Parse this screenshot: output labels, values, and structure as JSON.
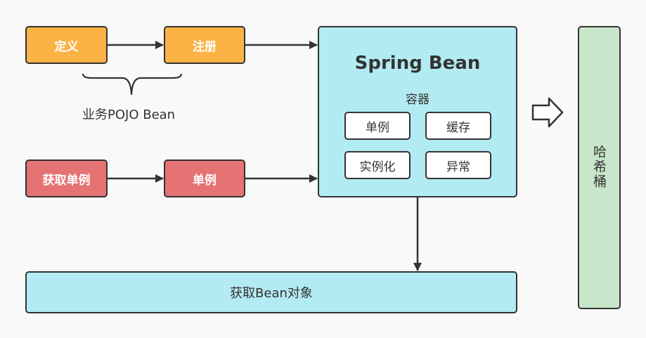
{
  "flow_top": {
    "define": "定义",
    "register": "注册",
    "brace_label": "业务POJO Bean"
  },
  "flow_bottom": {
    "get_singleton": "获取单例",
    "singleton": "单例"
  },
  "container": {
    "title": "Spring Bean",
    "subtitle": "容器",
    "items": [
      "单例",
      "缓存",
      "实例化",
      "异常"
    ]
  },
  "result": {
    "label": "获取Bean对象"
  },
  "hash_bucket": {
    "label": "哈希桶"
  },
  "colors": {
    "orange": "#fbb346",
    "red": "#e57373",
    "cyan": "#b3ebf2",
    "green": "#c8e6c9",
    "stroke": "#333333"
  }
}
